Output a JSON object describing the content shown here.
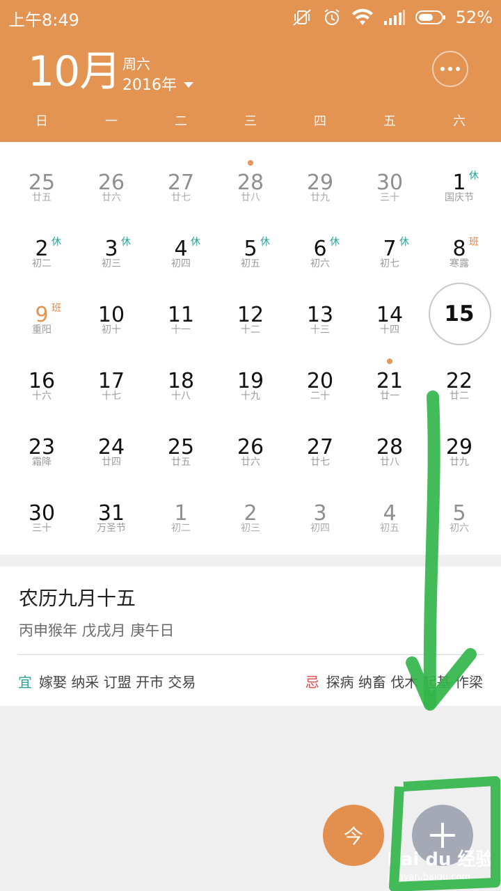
{
  "status_bar": {
    "time": "上午8:49",
    "battery": "52%",
    "icons": [
      "vibrate-off-icon",
      "alarm-icon",
      "wifi-icon",
      "signal-icon",
      "battery-icon"
    ]
  },
  "header": {
    "month": "10月",
    "weekday": "周六",
    "year": "2016年",
    "more_icon": "more-horizontal-icon",
    "accent_color": "#e39453"
  },
  "weekdays": [
    "日",
    "一",
    "二",
    "三",
    "四",
    "五",
    "六"
  ],
  "calendar": {
    "weeks": [
      [
        {
          "num": "25",
          "lunar": "廿五",
          "other": true
        },
        {
          "num": "26",
          "lunar": "廿六",
          "other": true
        },
        {
          "num": "27",
          "lunar": "廿七",
          "other": true
        },
        {
          "num": "28",
          "lunar": "廿八",
          "other": true,
          "dot": true
        },
        {
          "num": "29",
          "lunar": "廿九",
          "other": true
        },
        {
          "num": "30",
          "lunar": "三十",
          "other": true
        },
        {
          "num": "1",
          "lunar": "国庆节",
          "badge": "休"
        }
      ],
      [
        {
          "num": "2",
          "lunar": "初二",
          "badge": "休"
        },
        {
          "num": "3",
          "lunar": "初三",
          "badge": "休"
        },
        {
          "num": "4",
          "lunar": "初四",
          "badge": "休"
        },
        {
          "num": "5",
          "lunar": "初五",
          "badge": "休"
        },
        {
          "num": "6",
          "lunar": "初六",
          "badge": "休"
        },
        {
          "num": "7",
          "lunar": "初七",
          "badge": "休"
        },
        {
          "num": "8",
          "lunar": "寒露",
          "badge": "班"
        }
      ],
      [
        {
          "num": "9",
          "lunar": "重阳",
          "badge": "班",
          "highlight": true
        },
        {
          "num": "10",
          "lunar": "初十"
        },
        {
          "num": "11",
          "lunar": "十一"
        },
        {
          "num": "12",
          "lunar": "十二"
        },
        {
          "num": "13",
          "lunar": "十三"
        },
        {
          "num": "14",
          "lunar": "十四"
        },
        {
          "num": "15",
          "lunar": "",
          "today": true
        }
      ],
      [
        {
          "num": "16",
          "lunar": "十六"
        },
        {
          "num": "17",
          "lunar": "十七"
        },
        {
          "num": "18",
          "lunar": "十八"
        },
        {
          "num": "19",
          "lunar": "十九"
        },
        {
          "num": "20",
          "lunar": "二十"
        },
        {
          "num": "21",
          "lunar": "廿一",
          "dot": true
        },
        {
          "num": "22",
          "lunar": "廿二"
        }
      ],
      [
        {
          "num": "23",
          "lunar": "霜降"
        },
        {
          "num": "24",
          "lunar": "廿四"
        },
        {
          "num": "25",
          "lunar": "廿五"
        },
        {
          "num": "26",
          "lunar": "廿六"
        },
        {
          "num": "27",
          "lunar": "廿七"
        },
        {
          "num": "28",
          "lunar": "廿八"
        },
        {
          "num": "29",
          "lunar": "廿九"
        }
      ],
      [
        {
          "num": "30",
          "lunar": "三十"
        },
        {
          "num": "31",
          "lunar": "万圣节"
        },
        {
          "num": "1",
          "lunar": "初二",
          "other": true
        },
        {
          "num": "2",
          "lunar": "初三",
          "other": true
        },
        {
          "num": "3",
          "lunar": "初四",
          "other": true
        },
        {
          "num": "4",
          "lunar": "初五",
          "other": true
        },
        {
          "num": "5",
          "lunar": "初六",
          "other": true
        }
      ]
    ]
  },
  "details": {
    "lunar_date": "农历九月十五",
    "ganzhi": "丙申猴年 戊戌月 庚午日",
    "yi_label": "宜",
    "yi_items": "嫁娶 纳采 订盟 开市 交易",
    "ji_label": "忌",
    "ji_items": "探病 纳畜 伐木 起基 作梁"
  },
  "fab": {
    "today_label": "今",
    "add_icon": "plus-icon",
    "add_color": "#a5a9b6"
  },
  "watermark": {
    "logo": "Bai du 经验",
    "url": "jingyan.baidu.com"
  }
}
